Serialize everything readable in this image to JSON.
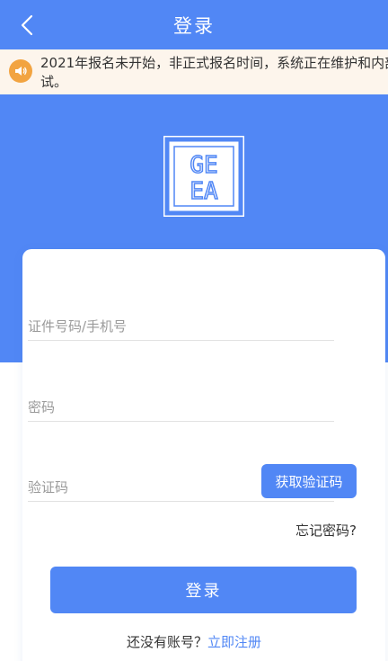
{
  "header": {
    "title": "登录",
    "back_icon": "chevron-left-icon"
  },
  "notice": {
    "icon": "speaker-icon",
    "line1": "2021年报名未开始，非正式报名时间，系统正在维护和内部",
    "line2": "试。"
  },
  "logo": {
    "row1": "GE",
    "row2": "EA"
  },
  "form": {
    "id_placeholder": "证件号码/手机号",
    "password_placeholder": "密码",
    "code_placeholder": "验证码",
    "get_code_label": "获取验证码",
    "forgot_label": "忘记密码?",
    "login_label": "登录",
    "no_account_text": "还没有账号？",
    "register_label": "立即注册"
  },
  "colors": {
    "primary": "#5187f5",
    "notice_bg": "#fdf5ec",
    "notice_icon": "#f2a441"
  }
}
